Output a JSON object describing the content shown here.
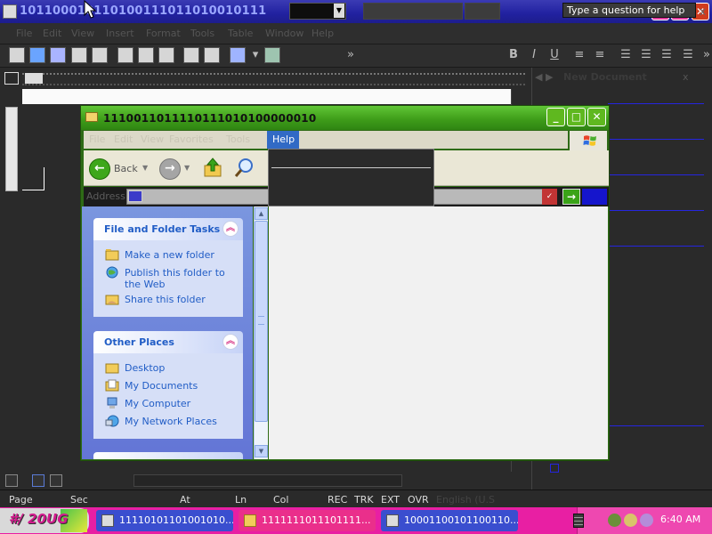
{
  "word": {
    "title": "101100010110100111011010010111",
    "menu": [
      "File",
      "Edit",
      "View",
      "Insert",
      "Format",
      "Tools",
      "Table",
      "Window",
      "Help"
    ],
    "help_question_placeholder": "Type a question for help",
    "help_close": "x",
    "toolbar_bold": "B",
    "toolbar_italic": "I",
    "toolbar_underline": "U",
    "taskpane_title": "New Document",
    "taskpane_close": "x",
    "statusbar": {
      "page": "Page",
      "sec": "Sec",
      "at": "At",
      "ln": "Ln",
      "col": "Col",
      "rec": "REC",
      "trk": "TRK",
      "ext": "EXT",
      "ovr": "OVR",
      "lang": "English (U.S"
    }
  },
  "explorer": {
    "title": "1110011011110111010100000010",
    "menu": [
      "File",
      "Edit",
      "View",
      "Favorites",
      "Tools",
      "Help"
    ],
    "active_menu": "Help",
    "toolbar": {
      "back": "Back",
      "forward": "",
      "up": "Up",
      "search": "Search"
    },
    "address_label": "Address",
    "address_value": "",
    "file_tasks": {
      "title": "File and Folder Tasks",
      "items": [
        {
          "label": "Make a new folder",
          "icon": "new-folder-icon"
        },
        {
          "label": "Publish this folder to the Web",
          "icon": "publish-web-icon"
        },
        {
          "label": "Share this folder",
          "icon": "share-folder-icon"
        }
      ]
    },
    "other_places": {
      "title": "Other Places",
      "items": [
        {
          "label": "Desktop",
          "icon": "desktop-folder-icon"
        },
        {
          "label": "My Documents",
          "icon": "my-documents-icon"
        },
        {
          "label": "My Computer",
          "icon": "my-computer-icon"
        },
        {
          "label": "My Network Places",
          "icon": "network-places-icon"
        }
      ]
    }
  },
  "taskbar": {
    "start_label": "#/ 20UG",
    "buttons": [
      {
        "label": "11110101101001010...",
        "color": "#3a4ecf"
      },
      {
        "label": "1111111011101111...",
        "color": "#ea2f8b"
      },
      {
        "label": "10001100101100110...",
        "color": "#3a4ecf"
      }
    ],
    "clock": "6:40 AM"
  },
  "colors": {
    "word_titlebar": "#2121a0",
    "explorer_titlebar": "#3f9e1a",
    "taskbar": "#e81fa3",
    "link_blue": "#215dc6"
  }
}
